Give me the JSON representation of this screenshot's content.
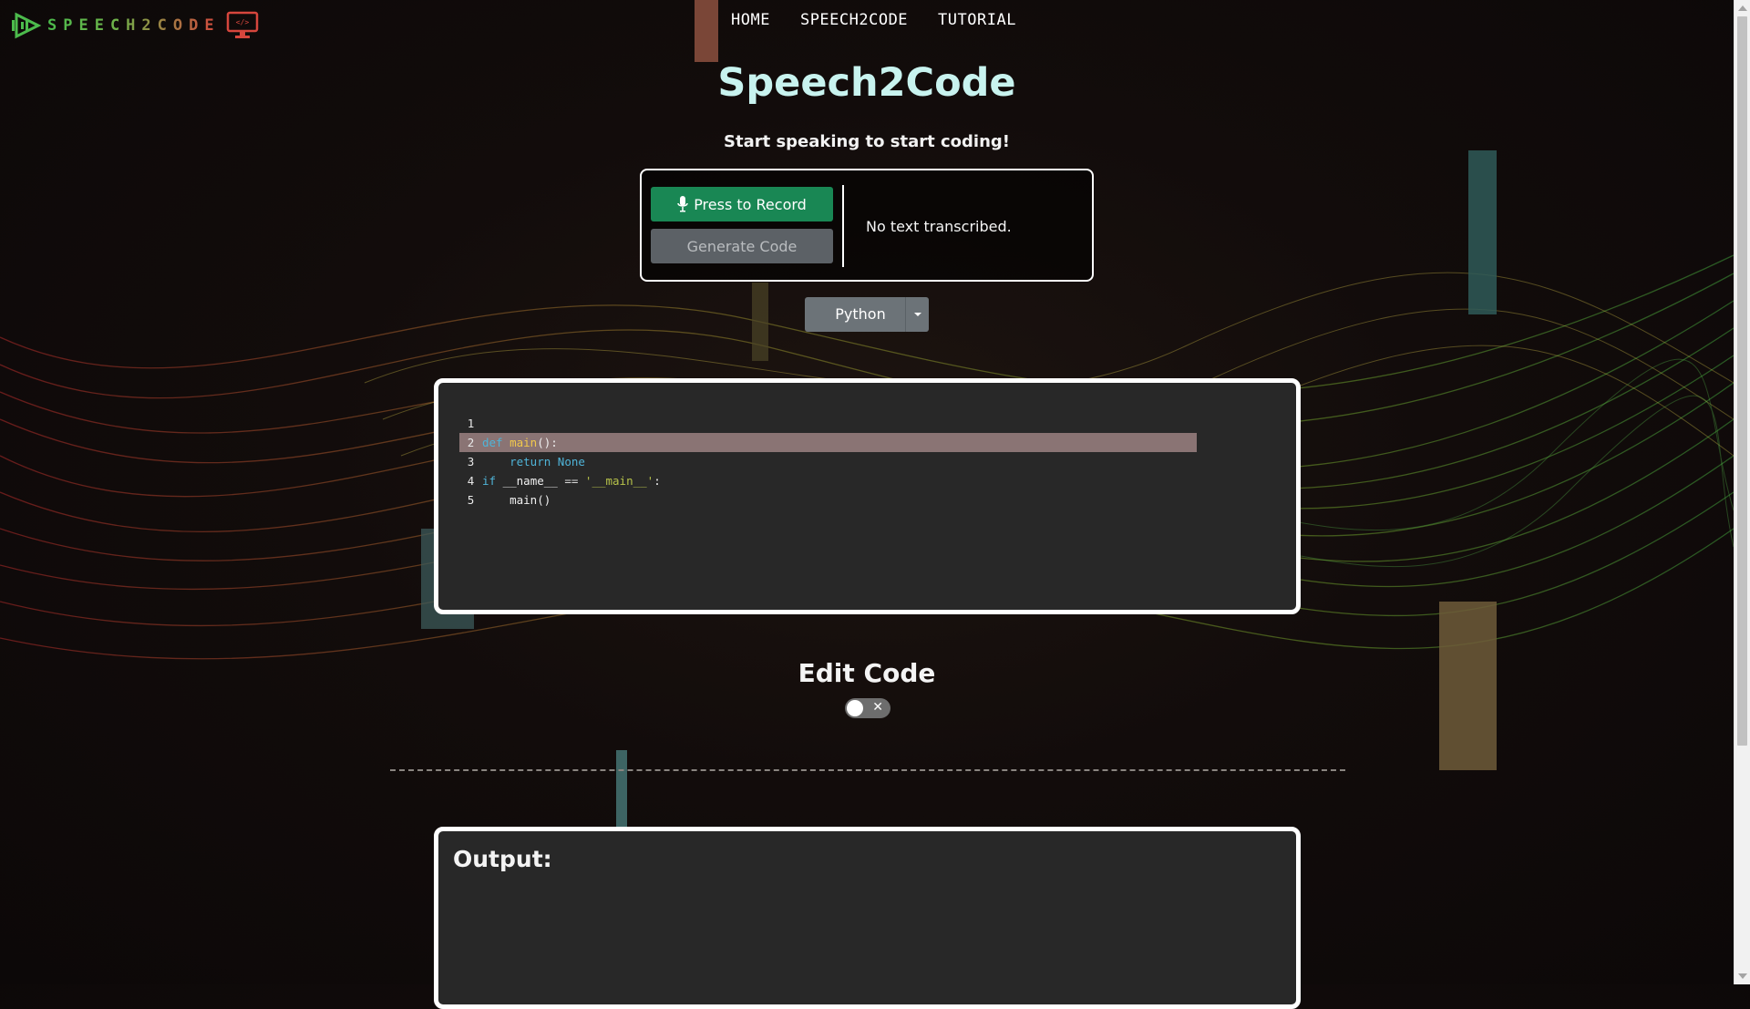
{
  "app": {
    "logo_text": "SPEECH2CODE"
  },
  "nav": {
    "items": [
      {
        "label": "HOME"
      },
      {
        "label": "SPEECH2CODE"
      },
      {
        "label": "TUTORIAL"
      }
    ]
  },
  "header": {
    "title": "Speech2Code",
    "subtitle": "Start speaking to start coding!"
  },
  "recorder": {
    "record_label": "Press to Record",
    "generate_label": "Generate Code",
    "transcript": "No text transcribed."
  },
  "language": {
    "selected": "Python"
  },
  "editor": {
    "lines": [
      {
        "number": "1",
        "code": ""
      },
      {
        "number": "2",
        "code": "def main():"
      },
      {
        "number": "3",
        "code": "    return None"
      },
      {
        "number": "4",
        "code": "if __name__ == '__main__':"
      },
      {
        "number": "5",
        "code": "    main()"
      }
    ],
    "active_line": 2
  },
  "edit_code": {
    "title": "Edit Code",
    "toggle_on": false
  },
  "output": {
    "title": "Output:"
  },
  "colors": {
    "record_button": "#198754",
    "generate_button": "#5c6166",
    "title_text": "#c8f3ef",
    "dropdown": "#6c7378"
  }
}
